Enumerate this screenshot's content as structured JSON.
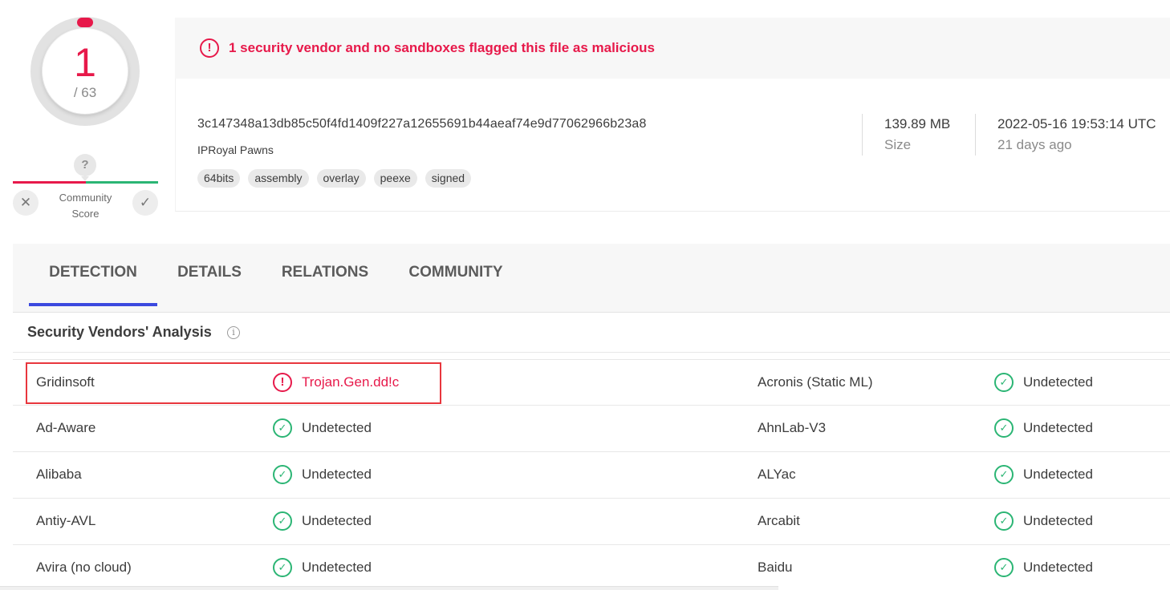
{
  "score": {
    "detections": "1",
    "total": "/ 63",
    "ring_color": "#e7194a"
  },
  "community": {
    "question": "?",
    "label_line1": "Community",
    "label_line2": "Score",
    "vote_down_icon": "close-icon",
    "vote_up_icon": "check-icon"
  },
  "alert": {
    "icon": "!",
    "text": "1 security vendor and no sandboxes flagged this file as malicious",
    "color": "#e7194a"
  },
  "file": {
    "hash": "3c147348a13db85c50f4fd1409f227a12655691b44aeaf74e9d77062966b23a8",
    "name": "IPRoyal Pawns",
    "tags": [
      "64bits",
      "assembly",
      "overlay",
      "peexe",
      "signed"
    ],
    "size_value": "139.89 MB",
    "size_label": "Size",
    "date_value": "2022-05-16 19:53:14 UTC",
    "date_relative": "21 days ago"
  },
  "tabs": [
    {
      "label": "DETECTION",
      "active": true
    },
    {
      "label": "DETAILS",
      "active": false
    },
    {
      "label": "RELATIONS",
      "active": false
    },
    {
      "label": "COMMUNITY",
      "active": false
    }
  ],
  "section": {
    "title": "Security Vendors' Analysis",
    "info_icon": "i"
  },
  "vendors": [
    {
      "left_name": "Gridinsoft",
      "left_result": "Trojan.Gen.dd!c",
      "left_status": "malicious",
      "right_name": "Acronis (Static ML)",
      "right_result": "Undetected",
      "right_status": "undetected"
    },
    {
      "left_name": "Ad-Aware",
      "left_result": "Undetected",
      "left_status": "undetected",
      "right_name": "AhnLab-V3",
      "right_result": "Undetected",
      "right_status": "undetected"
    },
    {
      "left_name": "Alibaba",
      "left_result": "Undetected",
      "left_status": "undetected",
      "right_name": "ALYac",
      "right_result": "Undetected",
      "right_status": "undetected"
    },
    {
      "left_name": "Antiy-AVL",
      "left_result": "Undetected",
      "left_status": "undetected",
      "right_name": "Arcabit",
      "right_result": "Undetected",
      "right_status": "undetected"
    },
    {
      "left_name": "Avira (no cloud)",
      "left_result": "Undetected",
      "left_status": "undetected",
      "right_name": "Baidu",
      "right_result": "Undetected",
      "right_status": "undetected"
    }
  ],
  "colors": {
    "malicious": "#e7194a",
    "clean": "#2bb574",
    "tab_indicator": "#3b49df",
    "highlight_box": "#e8363d"
  }
}
